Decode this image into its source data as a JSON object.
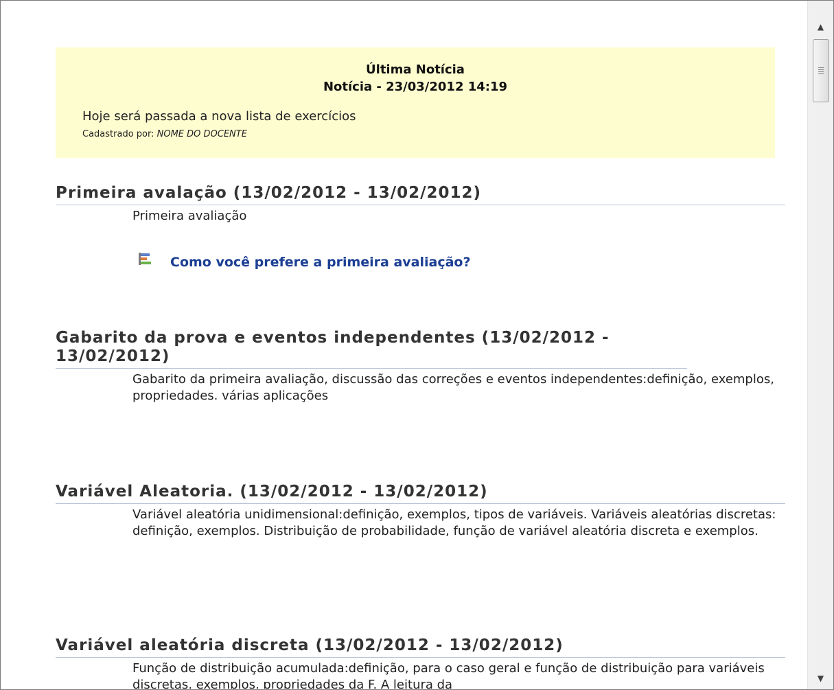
{
  "news": {
    "heading": "Última Notícia",
    "date": "Notícia - 23/03/2012 14:19",
    "text": "Hoje será passada a nova lista de exercícios",
    "registered_label": "Cadastrado por:",
    "registered_by": "NOME DO DOCENTE",
    "background_color": "#fefdd0"
  },
  "topics": [
    {
      "title": "Primeira avalação (13/02/2012 - 13/02/2012)",
      "description": "Primeira avaliação",
      "survey": {
        "icon": "bar-chart-icon",
        "label": "Como você prefere a primeira avaliação?"
      }
    },
    {
      "title": "Gabarito da prova e eventos independentes (13/02/2012 - 13/02/2012)",
      "description": "Gabarito da primeira avaliação, discussão das correções e eventos independentes:definição, exemplos, propriedades. várias aplicações"
    },
    {
      "title": "Variável Aleatoria. (13/02/2012 - 13/02/2012)",
      "description": "Variável aleatória unidimensional:definição, exemplos, tipos de variáveis. Variáveis aleatórias discretas: definição, exemplos. Distribuição de probabilidade, função de variável aleatória discreta e exemplos."
    },
    {
      "title": "Variável aleatória discreta (13/02/2012 - 13/02/2012)",
      "description": "Função de distribuição acumulada:definição, para o caso geral e função de distribuição para variáveis discretas, exemplos, propriedades da F. A leitura da"
    }
  ],
  "colors": {
    "link": "#1c3f94",
    "divider": "#b9c3d6"
  }
}
